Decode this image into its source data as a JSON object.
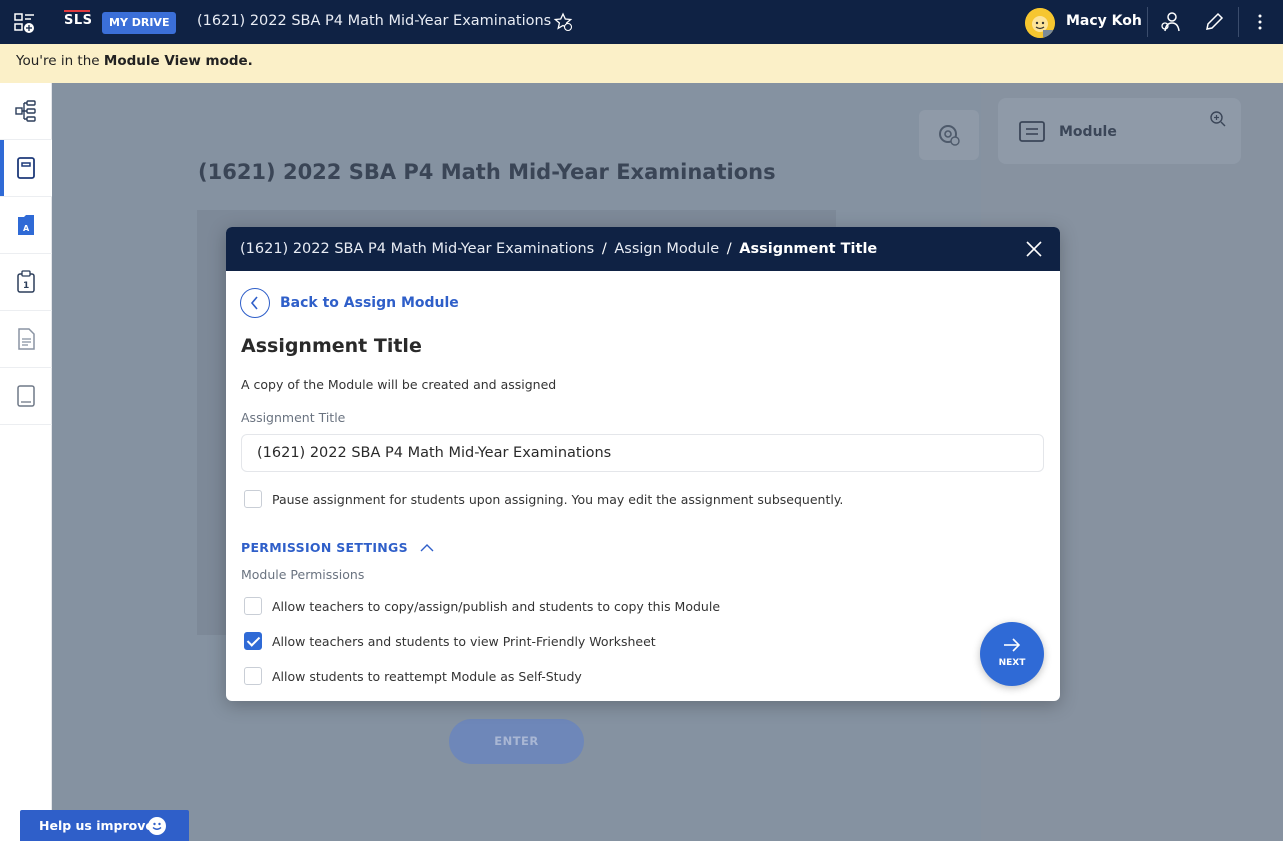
{
  "topbar": {
    "logo": "SLS",
    "drive_badge": "MY DRIVE",
    "title": "(1621) 2022 SBA P4 Math Mid-Year Examinations",
    "user_name": "Macy Koh"
  },
  "banner": {
    "prefix": "You're in the ",
    "mode": "Module View mode."
  },
  "background": {
    "page_title": "(1621) 2022 SBA P4 Math Mid-Year Examinations",
    "module_card_label": "Module",
    "enter_label": "ENTER",
    "help_label": "Help us improve"
  },
  "modal": {
    "breadcrumb": {
      "part1": "(1621) 2022 SBA P4 Math Mid-Year Examinations",
      "part2": "Assign Module",
      "current": "Assignment Title"
    },
    "back_label": "Back to Assign Module",
    "title": "Assignment Title",
    "description": "A copy of the Module will be created and assigned",
    "field_label": "Assignment Title",
    "field_value": "(1621) 2022 SBA P4 Math Mid-Year Examinations",
    "pause_label": "Pause assignment for students upon assigning. You may edit the assignment subsequently.",
    "permission_heading": "PERMISSION SETTINGS",
    "permission_sub": "Module Permissions",
    "permissions": [
      {
        "label": "Allow teachers to copy/assign/publish and students to copy this Module",
        "checked": false
      },
      {
        "label": "Allow teachers and students to view Print-Friendly Worksheet",
        "checked": true
      },
      {
        "label": "Allow students to reattempt Module as Self-Study",
        "checked": false
      }
    ],
    "next_label": "NEXT"
  },
  "colors": {
    "navy": "#0f2244",
    "accent_blue": "#2f6ad6",
    "banner_yellow": "#fbf0c8"
  }
}
